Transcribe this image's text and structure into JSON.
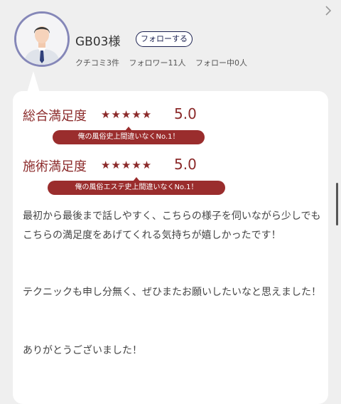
{
  "profile": {
    "username": "GB03様",
    "follow_label": "フォローする",
    "stats": [
      "クチコミ3件",
      "フォロワー11人",
      "フォロー中0人"
    ]
  },
  "ratings": [
    {
      "label": "総合満足度",
      "stars": "★★★★★",
      "score": "5.0",
      "badge": "俺の風俗史上間違いなくNo.1！"
    },
    {
      "label": "施術満足度",
      "stars": "★★★★★",
      "score": "5.0",
      "badge": "俺の風俗エステ史上間違いなくNo.1！"
    }
  ],
  "review": [
    "最初から最後まで話しやすく、こちらの様子を伺いながら少しでもこちらの満足度をあげてくれる気持ちが嬉しかったです！",
    "テクニックも申し分無く、ぜひまたお願いしたいなと思えました！",
    "ありがとうございました！"
  ],
  "icons": {
    "back": "chevron-right-icon",
    "avatar": "avatar-icon"
  },
  "colors": {
    "accent": "#8b2a2a",
    "badge": "#9a2d2d",
    "follow": "#1b2150",
    "avatar_ring": "#8587b8"
  }
}
